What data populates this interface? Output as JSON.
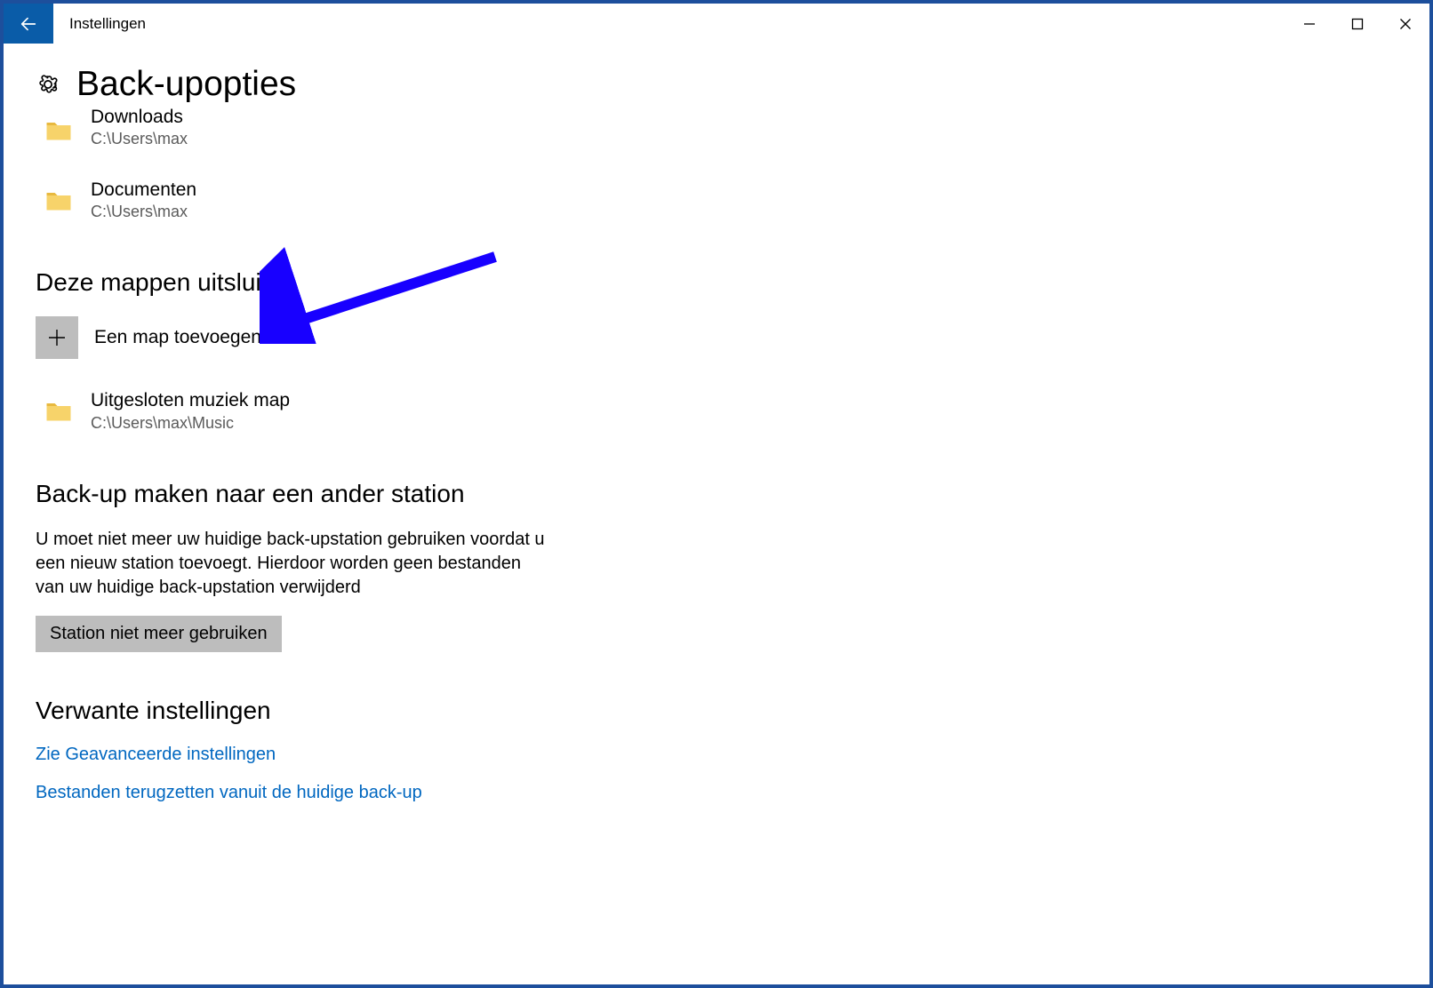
{
  "window": {
    "title": "Instellingen"
  },
  "page": {
    "title": "Back-upopties"
  },
  "included_folders": [
    {
      "name": "Downloads",
      "path": "C:\\Users\\max"
    },
    {
      "name": "Documenten",
      "path": "C:\\Users\\max"
    }
  ],
  "section_exclude": {
    "heading": "Deze mappen uitsluiten",
    "add_label": "Een map toevoegen",
    "folders": [
      {
        "name": "Uitgesloten muziek map",
        "path": "C:\\Users\\max\\Music"
      }
    ]
  },
  "section_other_drive": {
    "heading": "Back-up maken naar een ander station",
    "body": "U moet niet meer uw huidige back-upstation gebruiken voordat u een nieuw station toevoegt. Hierdoor worden geen bestanden van uw huidige back-upstation verwijderd",
    "button": "Station niet meer gebruiken"
  },
  "section_related": {
    "heading": "Verwante instellingen",
    "links": [
      "Zie Geavanceerde instellingen",
      "Bestanden terugzetten vanuit de huidige back-up"
    ]
  }
}
